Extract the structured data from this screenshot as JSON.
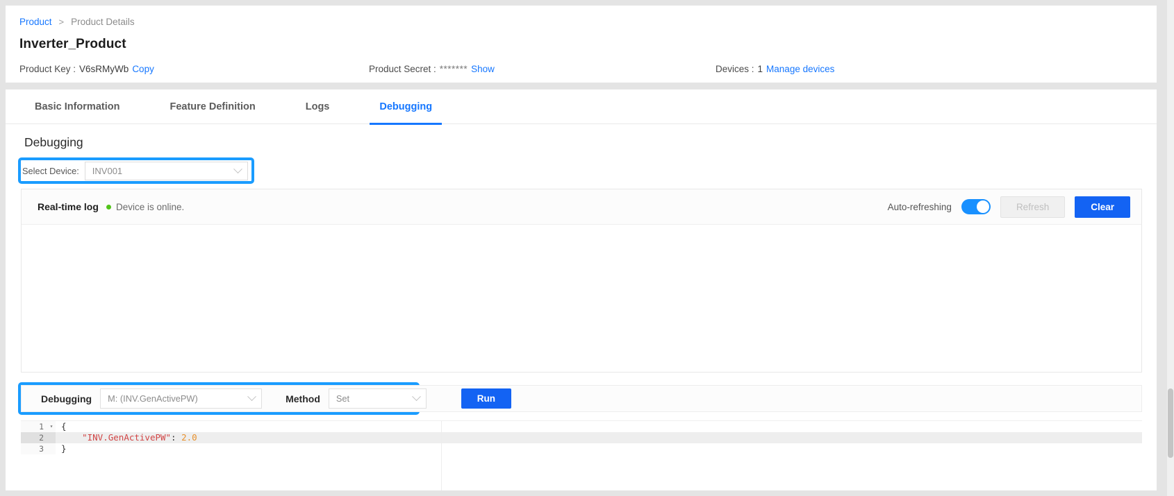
{
  "breadcrumb": {
    "root": "Product",
    "separator": ">",
    "current": "Product Details"
  },
  "product": {
    "title": "Inverter_Product",
    "key_label": "Product Key :",
    "key_value": "V6sRMyWb",
    "copy_label": "Copy",
    "secret_label": "Product Secret :",
    "secret_mask": "*******",
    "show_label": "Show",
    "devices_label": "Devices :",
    "devices_count": "1",
    "manage_devices_label": "Manage devices"
  },
  "tabs": [
    {
      "label": "Basic Information",
      "active": false
    },
    {
      "label": "Feature Definition",
      "active": false
    },
    {
      "label": "Logs",
      "active": false
    },
    {
      "label": "Debugging",
      "active": true
    }
  ],
  "debugging_section": {
    "heading": "Debugging",
    "select_device_label": "Select Device:",
    "selected_device": "INV001",
    "device_caret_icon": "chevron-down-icon"
  },
  "log_panel": {
    "title": "Real-time log",
    "status_text": "Device is online.",
    "status_dot_color": "#52c41a",
    "auto_refresh_label": "Auto-refreshing",
    "auto_refresh_on": true,
    "refresh_label": "Refresh",
    "refresh_disabled": true,
    "clear_label": "Clear",
    "log_lines": []
  },
  "debug_bar": {
    "debugging_label": "Debugging",
    "property_value": "M: (INV.GenActivePW)",
    "method_label": "Method",
    "method_value": "Set",
    "run_label": "Run",
    "caret_icon": "chevron-down-icon"
  },
  "editor": {
    "lines": [
      {
        "number": "1",
        "fold": "▾",
        "active": false,
        "punct_open": "{",
        "key": "",
        "colon": "",
        "value": "",
        "punct_close": ""
      },
      {
        "number": "2",
        "fold": "",
        "active": true,
        "punct_open": "",
        "key": "\"INV.GenActivePW\"",
        "colon": ":",
        "value": "2.0",
        "punct_close": ""
      },
      {
        "number": "3",
        "fold": "",
        "active": false,
        "punct_open": "}",
        "key": "",
        "colon": "",
        "value": "",
        "punct_close": ""
      }
    ]
  },
  "colors": {
    "accent": "#1677ff",
    "primary_button": "#1363f3",
    "highlight_outline": "#1a9cff",
    "online_green": "#52c41a",
    "toggle_on": "#1890ff"
  }
}
